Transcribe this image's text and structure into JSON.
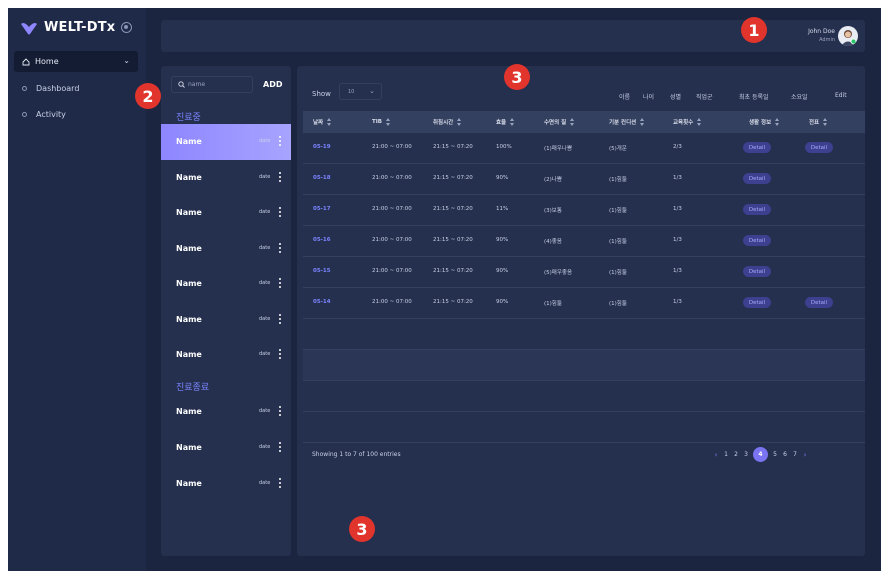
{
  "brand": {
    "name": "WELT-DTx"
  },
  "sidebar": {
    "home": "Home",
    "items": [
      {
        "label": "Dashboard"
      },
      {
        "label": "Activity"
      }
    ]
  },
  "header": {
    "user_name": "John Doe",
    "user_role": "Admin"
  },
  "list_panel": {
    "search_placeholder": "name",
    "add_label": "ADD",
    "section_active": "진료중",
    "section_done": "진료종료",
    "items_active": [
      {
        "name": "Name",
        "date": "date",
        "selected": true
      },
      {
        "name": "Name",
        "date": "date"
      },
      {
        "name": "Name",
        "date": "date"
      },
      {
        "name": "Name",
        "date": "date"
      },
      {
        "name": "Name",
        "date": "date"
      },
      {
        "name": "Name",
        "date": "date"
      },
      {
        "name": "Name",
        "date": "date"
      }
    ],
    "items_done": [
      {
        "name": "Name",
        "date": "date"
      },
      {
        "name": "Name",
        "date": "date"
      },
      {
        "name": "Name",
        "date": "date"
      }
    ]
  },
  "table": {
    "show_label": "Show",
    "show_value": "10",
    "column_toggles": [
      "이름",
      "나이",
      "성별",
      "직업군",
      "최초 등록일",
      "소요일"
    ],
    "edit_label": "Edit",
    "headers": [
      "날짜",
      "TIB",
      "취침시간",
      "효율",
      "수면의 질",
      "기분 컨디션",
      "교육횟수",
      "생활 정보",
      "전표"
    ],
    "rows": [
      [
        "05-19",
        "21:00 ~ 07:00",
        "21:15 ~ 07:20",
        "100%",
        "(1)매우나쁨",
        "(5)개운",
        "2/3",
        "Detail",
        "Detail"
      ],
      [
        "05-18",
        "21:00 ~ 07:00",
        "21:15 ~ 07:20",
        "90%",
        "(2)나쁨",
        "(1)힘듦",
        "1/3",
        "Detail",
        ""
      ],
      [
        "05-17",
        "21:00 ~ 07:00",
        "21:15 ~ 07:20",
        "11%",
        "(3)보통",
        "(1)힘듦",
        "1/3",
        "Detail",
        ""
      ],
      [
        "05-16",
        "21:00 ~ 07:00",
        "21:15 ~ 07:20",
        "90%",
        "(4)좋음",
        "(1)힘듦",
        "1/3",
        "Detail",
        ""
      ],
      [
        "05-15",
        "21:00 ~ 07:00",
        "21:15 ~ 07:20",
        "90%",
        "(5)매우좋음",
        "(1)힘듦",
        "1/3",
        "Detail",
        ""
      ],
      [
        "05-14",
        "21:00 ~ 07:00",
        "21:15 ~ 07:20",
        "90%",
        "(1)힘듦",
        "(1)힘듦",
        "1/3",
        "Detail",
        "Detail"
      ]
    ],
    "footer_info": "Showing 1 to 7 of 100 entries",
    "pages": [
      "1",
      "2",
      "3",
      "4",
      "5",
      "6",
      "7"
    ],
    "active_page": "4",
    "prev": "‹",
    "next": "›"
  },
  "callouts": [
    "1",
    "2",
    "3",
    "3"
  ],
  "colors": {
    "accent": "#7b84ff",
    "callout": "#e0342c",
    "bg": "#1b2540",
    "panel": "#25304f"
  }
}
